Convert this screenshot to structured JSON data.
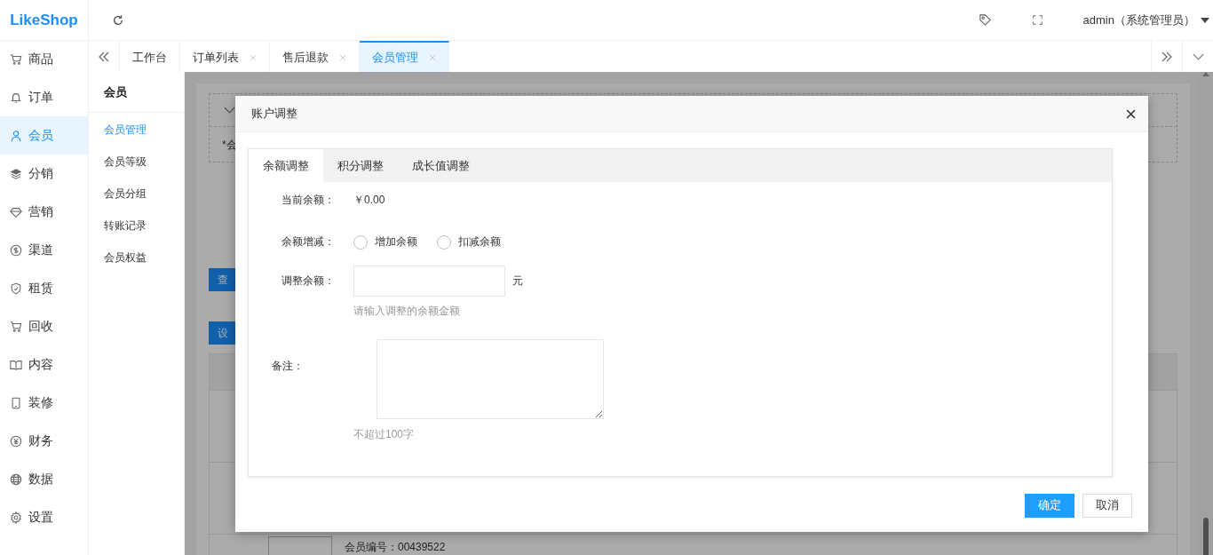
{
  "logo": "LikeShop",
  "user": "admin（系统管理员）",
  "sidebar": {
    "items": [
      {
        "label": "商品",
        "selected": false
      },
      {
        "label": "订单",
        "selected": false
      },
      {
        "label": "会员",
        "selected": true
      },
      {
        "label": "分销",
        "selected": false
      },
      {
        "label": "营销",
        "selected": false
      },
      {
        "label": "渠道",
        "selected": false
      },
      {
        "label": "租赁",
        "selected": false
      },
      {
        "label": "回收",
        "selected": false
      },
      {
        "label": "内容",
        "selected": false
      },
      {
        "label": "装修",
        "selected": false
      },
      {
        "label": "财务",
        "selected": false
      },
      {
        "label": "数据",
        "selected": false
      },
      {
        "label": "设置",
        "selected": false
      }
    ]
  },
  "tabs": [
    {
      "label": "工作台",
      "selected": false,
      "closable": false
    },
    {
      "label": "订单列表",
      "selected": false,
      "closable": true
    },
    {
      "label": "售后退款",
      "selected": false,
      "closable": true
    },
    {
      "label": "会员管理",
      "selected": true,
      "closable": true
    }
  ],
  "submenu": {
    "title": "会员",
    "items": [
      {
        "label": "会员管理",
        "selected": true
      },
      {
        "label": "会员等级",
        "selected": false
      },
      {
        "label": "会员分组",
        "selected": false
      },
      {
        "label": "转账记录",
        "selected": false
      },
      {
        "label": "会员权益",
        "selected": false
      }
    ]
  },
  "background": {
    "filter_fragment": "*会",
    "buttons": [
      "查",
      "设"
    ],
    "member_no": "会员编号：00439522"
  },
  "dialog": {
    "title": "账户调整",
    "tabs": [
      {
        "label": "余额调整",
        "selected": true
      },
      {
        "label": "积分调整",
        "selected": false
      },
      {
        "label": "成长值调整",
        "selected": false
      }
    ],
    "current_label": "当前余额：",
    "current_value": "￥0.00",
    "change_label": "余额增减：",
    "options": [
      {
        "label": "增加余额",
        "selected": false
      },
      {
        "label": "扣减余额",
        "selected": false
      }
    ],
    "amount_label": "调整余额：",
    "amount_unit": "元",
    "amount_hint": "请输入调整的余额金额",
    "remark_label": "备注：",
    "remark_hint": "不超过100字",
    "buttons": [
      {
        "label": "确定",
        "kind": "primary"
      },
      {
        "label": "取消",
        "kind": "default"
      }
    ]
  }
}
